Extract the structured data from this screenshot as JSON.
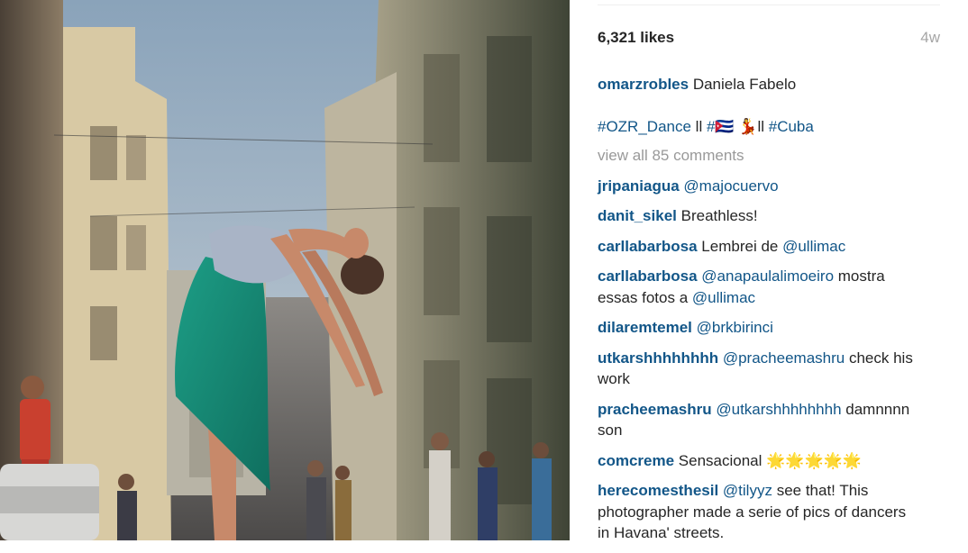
{
  "post": {
    "likes": "6,321 likes",
    "timestamp": "4w",
    "author": "omarzrobles",
    "caption": "Daniela Fabelo",
    "hashtags": {
      "tag1": "#OZR_Dance",
      "sep1": " ll ",
      "tag2": "#🇨🇺",
      "emoji": " 💃",
      "sep2": "ll ",
      "tag3": "#Cuba"
    },
    "view_all": "view all 85 comments"
  },
  "comments": [
    {
      "user": "jripaniagua",
      "parts": [
        {
          "m": "@majocuervo"
        }
      ]
    },
    {
      "user": "danit_sikel",
      "parts": [
        {
          "t": "Breathless!"
        }
      ]
    },
    {
      "user": "carllabarbosa",
      "parts": [
        {
          "t": "Lembrei de "
        },
        {
          "m": "@ullimac"
        }
      ]
    },
    {
      "user": "carllabarbosa",
      "parts": [
        {
          "m": "@anapaulalimoeiro"
        },
        {
          "t": " mostra essas fotos a "
        },
        {
          "m": "@ullimac"
        }
      ]
    },
    {
      "user": "dilaremtemel",
      "parts": [
        {
          "m": "@brkbirinci"
        }
      ]
    },
    {
      "user": "utkarshhhhhhhh",
      "parts": [
        {
          "m": "@pracheemashru"
        },
        {
          "t": " check his work"
        }
      ]
    },
    {
      "user": "pracheemashru",
      "parts": [
        {
          "m": "@utkarshhhhhhhh"
        },
        {
          "t": " damnnnn son"
        }
      ]
    },
    {
      "user": "comcreme",
      "parts": [
        {
          "t": "Sensacional 🌟🌟🌟🌟🌟"
        }
      ]
    },
    {
      "user": "herecomesthesil",
      "parts": [
        {
          "m": "@tilyyz"
        },
        {
          "t": " see that! This photographer made a serie of pics of dancers in Havana' streets."
        }
      ]
    }
  ],
  "colors": {
    "username": "#125688",
    "text": "#262626",
    "muted": "#999999",
    "timestamp": "#a6a6a6"
  }
}
